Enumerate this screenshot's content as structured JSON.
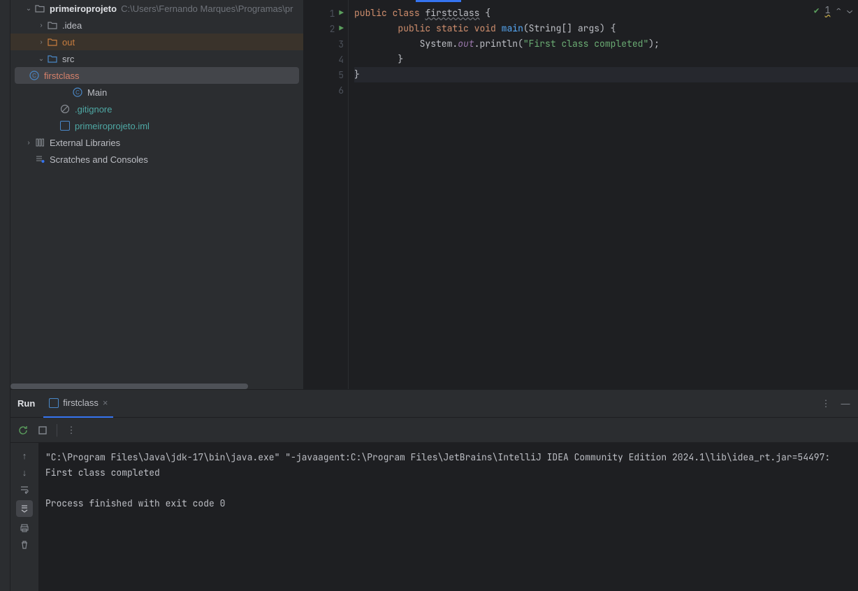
{
  "tree": {
    "project_name": "primeiroprojeto",
    "project_path": "C:\\Users\\Fernando Marques\\Programas\\pr",
    "idea_folder": ".idea",
    "out_folder": "out",
    "src_folder": "src",
    "firstclass": "firstclass",
    "main": "Main",
    "gitignore": ".gitignore",
    "iml": "primeiroprojeto.iml",
    "ext_libs": "External Libraries",
    "scratches": "Scratches and Consoles"
  },
  "editor": {
    "warning_count": "1",
    "lines": {
      "l1": "1",
      "l2": "2",
      "l3": "3",
      "l4": "4",
      "l5": "5",
      "l6": "6"
    },
    "tokens": {
      "public": "public",
      "class": "class",
      "firstclass": "firstclass",
      "brace_open": " {",
      "static": "static",
      "void": "void",
      "main": "main",
      "params": "(String[] args) {",
      "system": "System",
      "dot1": ".",
      "out": "out",
      "dot2": ".",
      "println": "println(",
      "string": "\"First class completed\"",
      "end": ");",
      "brace_close1": "        }",
      "brace_close2": "}"
    }
  },
  "run": {
    "title": "Run",
    "tab_label": "firstclass",
    "console_line1": "\"C:\\Program Files\\Java\\jdk-17\\bin\\java.exe\" \"-javaagent:C:\\Program Files\\JetBrains\\IntelliJ IDEA Community Edition 2024.1\\lib\\idea_rt.jar=54497:",
    "console_line2": "First class completed",
    "console_line3": "",
    "console_line4": "Process finished with exit code 0"
  }
}
